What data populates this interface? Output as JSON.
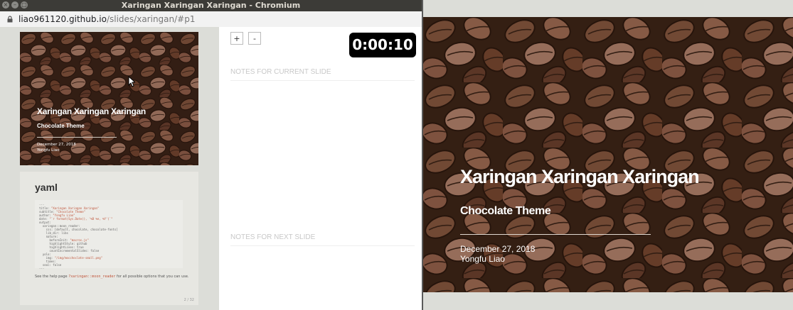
{
  "window": {
    "title": "Xaringan Xaringan Xaringan - Chromium",
    "buttons": {
      "close": "×",
      "minimize": "–",
      "maximize": "□"
    }
  },
  "address": {
    "host": "liao961120.github.io",
    "path": "/slides/xaringan/#p1"
  },
  "current_slide": {
    "title": "Xaringan Xaringan Xaringan",
    "subtitle": "Chocolate Theme",
    "date": "December 27, 2018",
    "author": "Yongfu Liao"
  },
  "next_slide": {
    "heading": "yaml",
    "code_lines": [
      {
        "k": "---",
        "v": ""
      },
      {
        "k": "title: ",
        "v": "\"Xaringan Xaringan Xaringan\""
      },
      {
        "k": "subtitle: ",
        "v": "\"Chocolate Theme\""
      },
      {
        "k": "author: ",
        "v": "\"Yongfu Liao\""
      },
      {
        "k": "date: ",
        "v": "\"`r format(Sys.Date(), '%B %e, %Y')`\""
      },
      {
        "k": "output:",
        "v": ""
      },
      {
        "k": "  xaringan::moon_reader:",
        "v": ""
      },
      {
        "k": "    css: [default, chocolate, chocolate-fonts]",
        "v": ""
      },
      {
        "k": "    lib_dir: libs",
        "v": ""
      },
      {
        "k": "    nature:",
        "v": ""
      },
      {
        "k": "      beforeInit: ",
        "v": "\"macros.js\""
      },
      {
        "k": "      highlightStyle: github",
        "v": ""
      },
      {
        "k": "      highlightLines: true",
        "v": ""
      },
      {
        "k": "      countIncrementalSlides: false",
        "v": ""
      },
      {
        "k": "  yolo:",
        "v": ""
      },
      {
        "k": "    img: ",
        "v": "\"/img/mocchoclate-small.png\""
      },
      {
        "k": "    times:",
        "v": ""
      },
      {
        "k": "  seal: false",
        "v": ""
      },
      {
        "k": "---",
        "v": ""
      }
    ],
    "help_before": "See the help page ",
    "help_code": "?xaringan::moon_reader",
    "help_after": " for all possible options that you can use.",
    "page": "2 / 32"
  },
  "presenter": {
    "zoom_in": "+",
    "zoom_out": "-",
    "timer": "0:00:10",
    "notes_current": "NOTES FOR CURRENT SLIDE",
    "notes_next": "NOTES FOR NEXT SLIDE"
  },
  "colors": {
    "timer_bg": "#000000",
    "titlebar": "#3c3b37",
    "bean_dark": "#3a2316"
  }
}
